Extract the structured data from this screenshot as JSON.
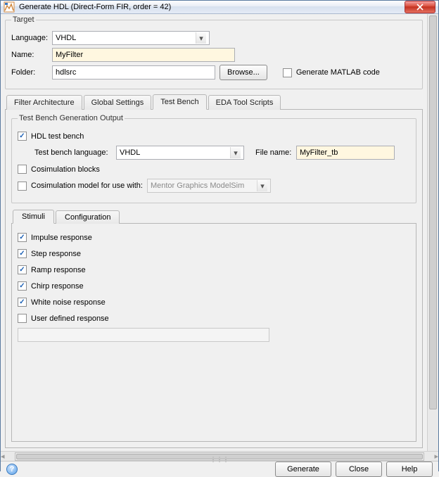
{
  "window": {
    "title": "Generate HDL (Direct-Form FIR, order = 42)"
  },
  "target": {
    "legend": "Target",
    "language_label": "Language:",
    "language_value": "VHDL",
    "name_label": "Name:",
    "name_value": "MyFilter",
    "folder_label": "Folder:",
    "folder_value": "hdlsrc",
    "browse_label": "Browse...",
    "gen_matlab_label": "Generate MATLAB code"
  },
  "main_tabs": [
    "Filter Architecture",
    "Global Settings",
    "Test Bench",
    "EDA Tool Scripts"
  ],
  "testbench": {
    "group_legend": "Test Bench Generation Output",
    "hdl_tb_label": "HDL test bench",
    "tb_lang_label": "Test bench language:",
    "tb_lang_value": "VHDL",
    "file_name_label": "File name:",
    "file_name_value": "MyFilter_tb",
    "cosim_blocks_label": "Cosimulation blocks",
    "cosim_model_label": "Cosimulation model for use with:",
    "cosim_model_value": "Mentor Graphics ModelSim"
  },
  "sub_tabs": [
    "Stimuli",
    "Configuration"
  ],
  "stimuli": {
    "impulse": "Impulse response",
    "step": "Step response",
    "ramp": "Ramp response",
    "chirp": "Chirp response",
    "whitenoise": "White noise response",
    "userdef": "User defined response"
  },
  "footer": {
    "generate": "Generate",
    "close": "Close",
    "help": "Help"
  }
}
